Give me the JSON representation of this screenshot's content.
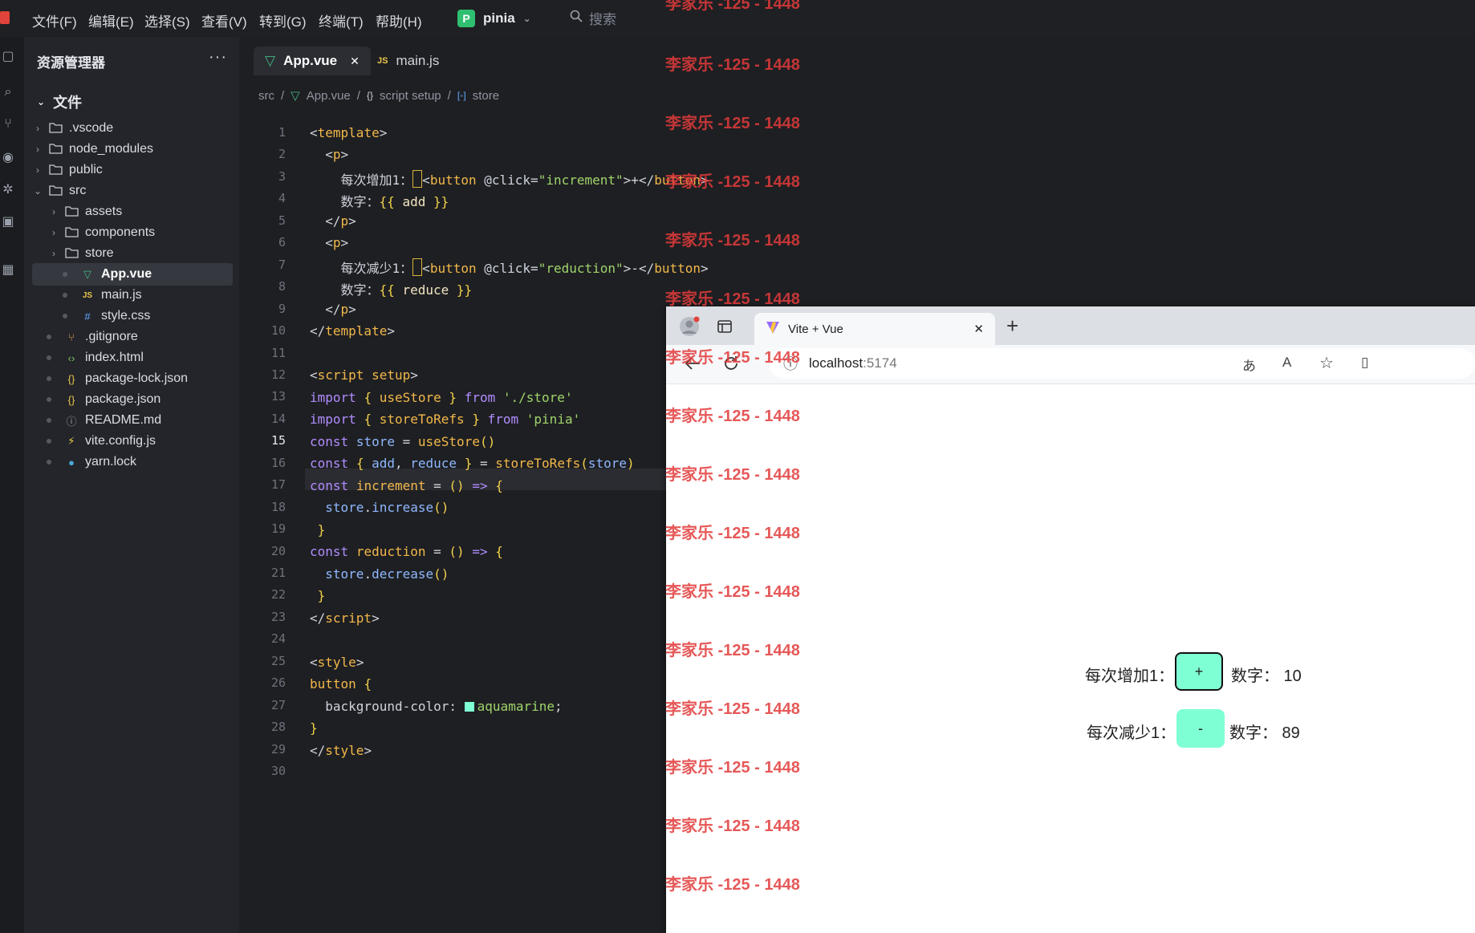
{
  "menubar": {
    "items": [
      "文件(F)",
      "编辑(E)",
      "选择(S)",
      "查看(V)",
      "转到(G)",
      "终端(T)",
      "帮助(H)"
    ],
    "project_badge": "P",
    "project_name": "pinia",
    "search_placeholder": "搜索"
  },
  "explorer": {
    "title": "资源管理器",
    "more": "···",
    "section": "文件",
    "items": [
      {
        "label": ".vscode"
      },
      {
        "label": "node_modules"
      },
      {
        "label": "public"
      },
      {
        "label": "src"
      },
      {
        "label": "assets"
      },
      {
        "label": "components"
      },
      {
        "label": "store"
      },
      {
        "label": "App.vue"
      },
      {
        "label": "main.js"
      },
      {
        "label": "style.css"
      },
      {
        "label": ".gitignore"
      },
      {
        "label": "index.html"
      },
      {
        "label": "package-lock.json"
      },
      {
        "label": "package.json"
      },
      {
        "label": "README.md"
      },
      {
        "label": "vite.config.js"
      },
      {
        "label": "yarn.lock"
      }
    ]
  },
  "tabs": [
    {
      "label": "App.vue",
      "close": "✕"
    },
    {
      "label": "main.js",
      "icon": "JS"
    }
  ],
  "breadcrumb": [
    "src",
    "App.vue",
    "script setup",
    "store"
  ],
  "breadcrumb_sep": "/",
  "editor": {
    "line_numbers": [
      "1",
      "2",
      "3",
      "4",
      "5",
      "6",
      "7",
      "8",
      "9",
      "10",
      "11",
      "12",
      "13",
      "14",
      "15",
      "16",
      "17",
      "18",
      "19",
      "20",
      "21",
      "22",
      "23",
      "24",
      "25",
      "26",
      "27",
      "28",
      "29",
      "30"
    ],
    "current_line": "15",
    "code": {
      "l1": "template",
      "l3_text": "每次增加1：",
      "l3_btn": "button",
      "l3_attr": "@click",
      "l3_val": "\"increment\"",
      "l3_body": "+",
      "l4_text": "数字：",
      "l4_expr": "add",
      "l7_text": "每次减少1：",
      "l7_val": "\"reduction\"",
      "l7_body": "-",
      "l8_expr": "reduce",
      "l12_tag": "script",
      "l12_attr": "setup",
      "l13_ident": "useStore",
      "l13_path": "'./store'",
      "l14_ident": "storeToRefs",
      "l14_path": "'pinia'",
      "kw_import": "import",
      "kw_from": "from",
      "kw_const": "const",
      "l15_var": "store",
      "l15_fn": "useStore",
      "l16_a": "add",
      "l16_b": "reduce",
      "l16_fn": "storeToRefs",
      "l16_arg": "store",
      "l17_fn": "increment",
      "l18_call": "increase",
      "l20_fn": "reduction",
      "l21_call": "decrease",
      "p_tag": "p",
      "style_tag": "style",
      "l26_sel": "button",
      "l27_prop": "background-color",
      "l27_val": "aquamarine"
    }
  },
  "browser": {
    "tab_title": "Vite + Vue",
    "tab_close": "✕",
    "new_tab": "+",
    "url_host": "localhost",
    "url_port": ":5174",
    "row1_label": "每次增加1：",
    "row1_btn": "+",
    "row1_value": "数字：  10",
    "row2_label": "每次减少1：",
    "row2_btn": "-",
    "row2_value": "数字：  89"
  },
  "watermark": "李家乐 -125 - 1448",
  "colors": {
    "accent_green": "#2fbf71",
    "button_bg": "#7fffd4",
    "watermark": "#e23b3b"
  }
}
